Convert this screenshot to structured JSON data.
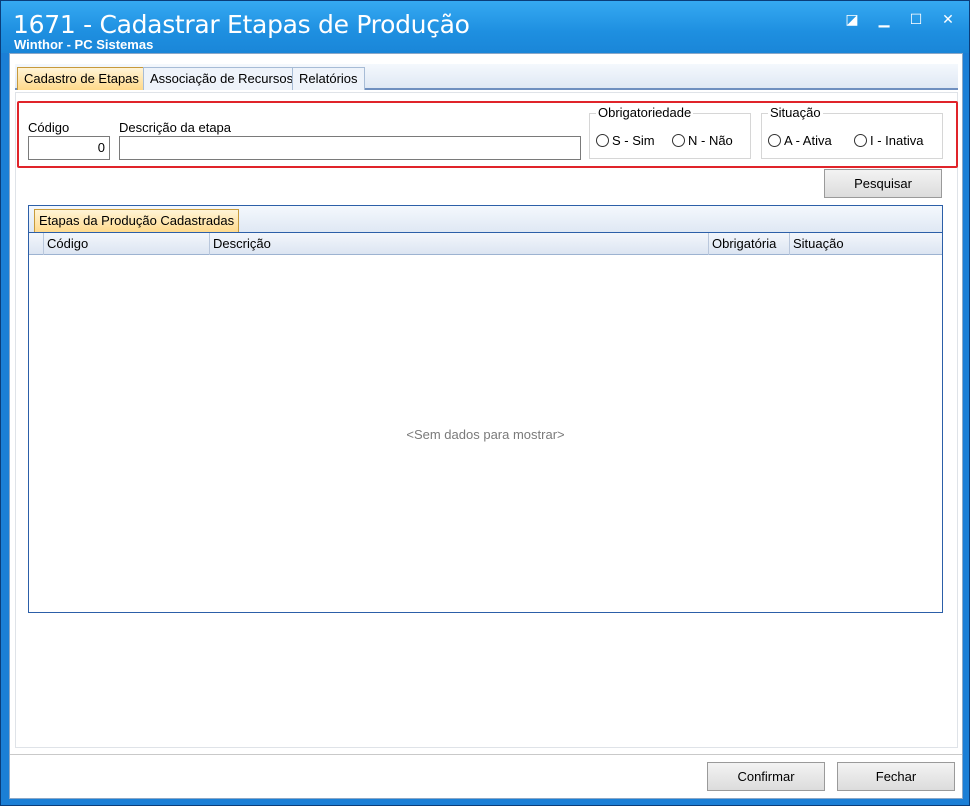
{
  "window": {
    "title": "1671 - Cadastrar Etapas de Produção",
    "subtitle": "Winthor - PC Sistemas",
    "controls": {
      "restore": "◪",
      "minimize": "▁",
      "maximize": "☐",
      "close": "✕"
    }
  },
  "tabs": [
    {
      "label": "Cadastro de Etapas",
      "active": true
    },
    {
      "label": "Associação de Recursos",
      "active": false
    },
    {
      "label": "Relatórios",
      "active": false
    }
  ],
  "filters": {
    "code_label": "Código",
    "code_value": "0",
    "description_label": "Descrição da etapa",
    "description_value": "",
    "mandatory": {
      "title": "Obrigatoriedade",
      "options": [
        "S - Sim",
        "N - Não"
      ]
    },
    "status": {
      "title": "Situação",
      "options": [
        "A - Ativa",
        "I - Inativa"
      ]
    },
    "highlight_color": "#e0242a"
  },
  "search_button": "Pesquisar",
  "grid": {
    "tab_label": "Etapas da Produção Cadastradas",
    "columns": [
      "Código",
      "Descrição",
      "Obrigatória",
      "Situação"
    ],
    "rows": [],
    "empty_message": "<Sem dados para mostrar>"
  },
  "footer": {
    "confirm": "Confirmar",
    "close": "Fechar"
  }
}
